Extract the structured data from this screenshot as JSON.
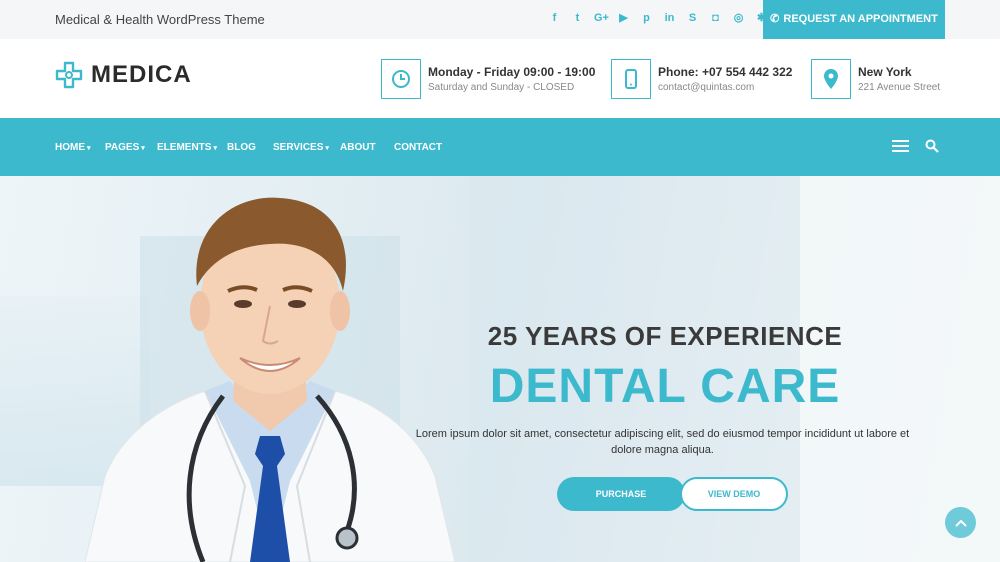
{
  "topbar": {
    "tagline": "Medical & Health WordPress Theme",
    "socials": [
      {
        "icon": "facebook-icon",
        "glyph": "f"
      },
      {
        "icon": "twitter-icon",
        "glyph": "t"
      },
      {
        "icon": "google-plus-icon",
        "glyph": "G+"
      },
      {
        "icon": "youtube-icon",
        "glyph": "▶"
      },
      {
        "icon": "pinterest-icon",
        "glyph": "p"
      },
      {
        "icon": "linkedin-icon",
        "glyph": "in"
      },
      {
        "icon": "skype-icon",
        "glyph": "S"
      },
      {
        "icon": "instagram-icon",
        "glyph": "◘"
      },
      {
        "icon": "dribbble-icon",
        "glyph": "◎"
      },
      {
        "icon": "yelp-icon",
        "glyph": "✱"
      }
    ],
    "appointment_label": "REQUEST AN APPOINTMENT"
  },
  "header": {
    "logo_text": "MEDICA",
    "hours_title": "Monday - Friday 09:00 - 19:00",
    "hours_sub": "Saturday and Sunday - CLOSED",
    "phone_title": "Phone: +07 554 442 322",
    "phone_sub": "contact@quintas.com",
    "location_title": "New York",
    "location_sub": "221 Avenue Street"
  },
  "nav": {
    "items": [
      {
        "label": "HOME",
        "dropdown": true
      },
      {
        "label": "PAGES",
        "dropdown": true
      },
      {
        "label": "ELEMENTS",
        "dropdown": true
      },
      {
        "label": "BLOG",
        "dropdown": false
      },
      {
        "label": "SERVICES",
        "dropdown": true
      },
      {
        "label": "ABOUT",
        "dropdown": false
      },
      {
        "label": "CONTACT",
        "dropdown": false
      }
    ]
  },
  "hero": {
    "subtitle": "25 YEARS OF EXPERIENCE",
    "title": "DENTAL CARE",
    "description": "Lorem ipsum dolor sit amet, consectetur adipiscing elit, sed do eiusmod tempor incididunt ut labore et dolore magna aliqua.",
    "purchase_label": "PURCHASE",
    "demo_label": "VIEW DEMO"
  },
  "colors": {
    "accent": "#3cb9cc",
    "dark_text": "#333333"
  }
}
